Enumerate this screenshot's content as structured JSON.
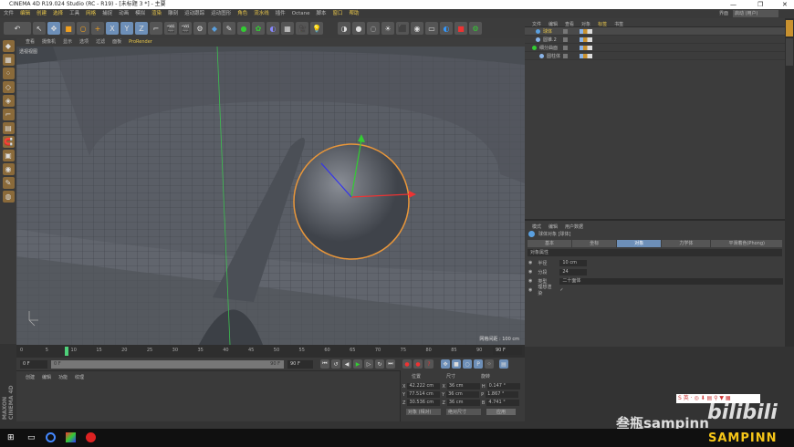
{
  "window": {
    "title": "CINEMA 4D R19.024 Studio (RC - R19) - [未标题 3 *] - 主要",
    "minimize": "—",
    "restore": "❐",
    "close": "✕"
  },
  "menu": [
    "文件",
    "编辑",
    "创建",
    "选择",
    "工具",
    "网格",
    "捕捉",
    "动画",
    "模拟",
    "渲染",
    "雕刻",
    "运动跟踪",
    "运动图形",
    "角色",
    "流水线",
    "插件",
    "Octane",
    "脚本",
    "窗口",
    "帮助"
  ],
  "layout": {
    "label": "界面",
    "value": "启动 (用户)"
  },
  "viewport": {
    "menu": [
      "查看",
      "摄像机",
      "显示",
      "选项",
      "过滤",
      "面板",
      "ProRender"
    ],
    "view_name": "透视视图",
    "grid_spacing": "网格间距 : 100 cm",
    "colors": {
      "bg": "#5a5e66",
      "selection": "#e8963a"
    }
  },
  "timeline": {
    "ticks": [
      "0",
      "5",
      "10",
      "15",
      "20",
      "25",
      "30",
      "35",
      "40",
      "45",
      "50",
      "55",
      "60",
      "65",
      "70",
      "75",
      "80",
      "85",
      "90"
    ],
    "current_frame": 9,
    "end_field": "90 F",
    "start": "0 F",
    "range_start": "0 F",
    "range_end": "90 F",
    "max": "90 F"
  },
  "material": {
    "menu": [
      "创建",
      "编辑",
      "功能",
      "纹理"
    ]
  },
  "coords": {
    "headers": [
      "位置",
      "尺寸",
      "旋转"
    ],
    "rows": [
      [
        "X",
        "42.222 cm",
        "X",
        "36 cm",
        "H",
        "0.147 °"
      ],
      [
        "Y",
        "77.514 cm",
        "Y",
        "36 cm",
        "P",
        "1.867 °"
      ],
      [
        "Z",
        "30.536 cm",
        "Z",
        "36 cm",
        "B",
        "4.741 °"
      ]
    ],
    "mode": "对象 (相对)",
    "size_mode": "绝对尺寸",
    "apply": "应用"
  },
  "brand": "MAXON CINEMA 4D",
  "objects": {
    "menu": [
      "文件",
      "编辑",
      "查看",
      "对象",
      "标签",
      "书签"
    ],
    "items": [
      {
        "name": "球体",
        "selected": true,
        "indent": 1
      },
      {
        "name": "圆锥.2",
        "indent": 1
      },
      {
        "name": "细分曲面",
        "indent": 0
      },
      {
        "name": "圆柱体",
        "indent": 2
      }
    ]
  },
  "attributes": {
    "menu": [
      "模式",
      "编辑",
      "用户数据"
    ],
    "object_title": "球体对象 [球体]",
    "tabs": [
      "基本",
      "坐标",
      "对象",
      "力学体",
      "平滑着色(Phong)"
    ],
    "active_tab": 2,
    "section": "对象属性",
    "fields": [
      {
        "label": "半径",
        "value": "10 cm"
      },
      {
        "label": "分段",
        "value": "24"
      },
      {
        "label": "类型",
        "value": "二十面体"
      },
      {
        "label": "理想渲染",
        "value": "✓"
      }
    ]
  },
  "watermark": {
    "text": "叁瓶sampinn",
    "logo": "bilibili",
    "banner": "SAMPINN"
  },
  "ime": "S 英 · ◎ ⬇ ▤ ⚲ ▼ ▦"
}
